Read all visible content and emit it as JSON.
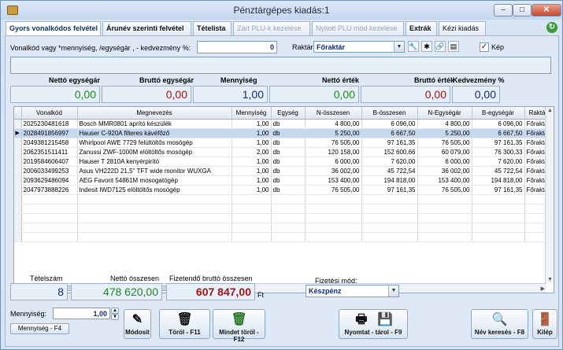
{
  "window": {
    "title": "Pénztárgépes kiadás:1"
  },
  "tabs": [
    {
      "label": "Gyors vonalkódos felvétel",
      "state": "active"
    },
    {
      "label": "Árunév szerinti felvétel",
      "state": "normal"
    },
    {
      "label": "Tételista",
      "state": "normal"
    },
    {
      "label": "Zárt PLU-k kezelése",
      "state": "disabled"
    },
    {
      "label": "Nyitott PLU mód kezelése",
      "state": "disabled"
    },
    {
      "label": "Extrák",
      "state": "normal"
    },
    {
      "label": "Kézi kiadás",
      "state": "plain"
    }
  ],
  "entry": {
    "barcode_label": "Vonalkód vagy *mennyiség, /egységár , - kedvezmény %:",
    "barcode_value": "0",
    "warehouse_label": "Raktár:",
    "warehouse_value": "Főraktár",
    "image_checkbox_label": "Kép",
    "image_checked": "✓"
  },
  "summary": {
    "net_unit_label": "Nettó egységár",
    "net_unit_value": "0,00",
    "gross_unit_label": "Bruttó egységár",
    "gross_unit_value": "0,00",
    "qty_label": "Mennyiség",
    "qty_value": "1,00",
    "net_value_label": "Nettó érték",
    "net_value_value": "0,00",
    "gross_value_label": "Bruttó érték",
    "gross_value_value": "0,00",
    "discount_label": "Kedvezmény %",
    "discount_value": "0,00"
  },
  "table": {
    "headers": [
      "Vonalkód",
      "Megnevezés",
      "Mennyiség",
      "Egység",
      "N-összesen",
      "B-összesen",
      "N-Egységár",
      "B-egységár",
      "Raktár"
    ],
    "rows": [
      [
        "2025230481618",
        "Bosch MMR0801 aprító készülék",
        "1,00",
        "db",
        "4 800,00",
        "6 096,00",
        "4 800,00",
        "6 096,00",
        "Főraktár"
      ],
      [
        "2028491856997",
        "Hauser C-920A filteres kávéfőző",
        "1,00",
        "db",
        "5 250,00",
        "6 667,50",
        "5 250,00",
        "6 667,50",
        "Főraktár"
      ],
      [
        "2049381215458",
        "Whirlpool AWE 7729 felültöltős mosógép",
        "1,00",
        "db",
        "76 505,00",
        "97 161,35",
        "76 505,00",
        "97 161,35",
        "Főraktár"
      ],
      [
        "2062351511411",
        "Zanussi ZWF-1000M elöltöltős mosógép",
        "2,00",
        "db",
        "120 158,00",
        "152 600,66",
        "60 079,00",
        "76 300,33",
        "Főraktár"
      ],
      [
        "2019584606407",
        "Hauser T 2810A kenyérpirító",
        "1,00",
        "db",
        "6 000,00",
        "7 620,00",
        "6 000,00",
        "7 620,00",
        "Főraktár"
      ],
      [
        "2006033499253",
        "Asus VH222D 21,5\" TFT wide monitor WUXGA",
        "1,00",
        "db",
        "36 002,00",
        "45 722,54",
        "36 002,00",
        "45 722,54",
        "Főraktár"
      ],
      [
        "2093629486094",
        "AEG Favorit 54861M mosogatógép",
        "1,00",
        "db",
        "153 400,00",
        "194 818,00",
        "153 400,00",
        "194 818,00",
        "Főraktár"
      ],
      [
        "2047973888226",
        "Indesit IWD7125 elöltöltős mosógép",
        "1,00",
        "db",
        "76 505,00",
        "97 161,35",
        "76 505,00",
        "97 161,35",
        "Főraktár"
      ]
    ],
    "selected_row": 1
  },
  "totals": {
    "count_label": "Tételszám",
    "count_value": "8",
    "net_total_label": "Nettó összesen",
    "net_total_value": "478 620,00",
    "gross_total_label": "Fizetendő bruttó összesen",
    "gross_total_value": "607 847,00",
    "currency": "Ft",
    "payment_label": "Fizetési mód:",
    "payment_value": "Készpénz"
  },
  "footer": {
    "qty_label": "Mennyiség:",
    "qty_value": "1,00",
    "qty_button": "Mennyiség - F4",
    "modify_button": "Módosít",
    "delete_button": "Töröl - F11",
    "delete_all_button": "Mindet töröl - F12",
    "print_save_button": "Nyomtat - tárol - F9",
    "name_search_button": "Név keresés - F8",
    "exit_button": "Kilép"
  },
  "colors": {
    "net_green": "#1a8a1a",
    "gross_red": "#a31313",
    "blue_value": "#102a7a"
  }
}
